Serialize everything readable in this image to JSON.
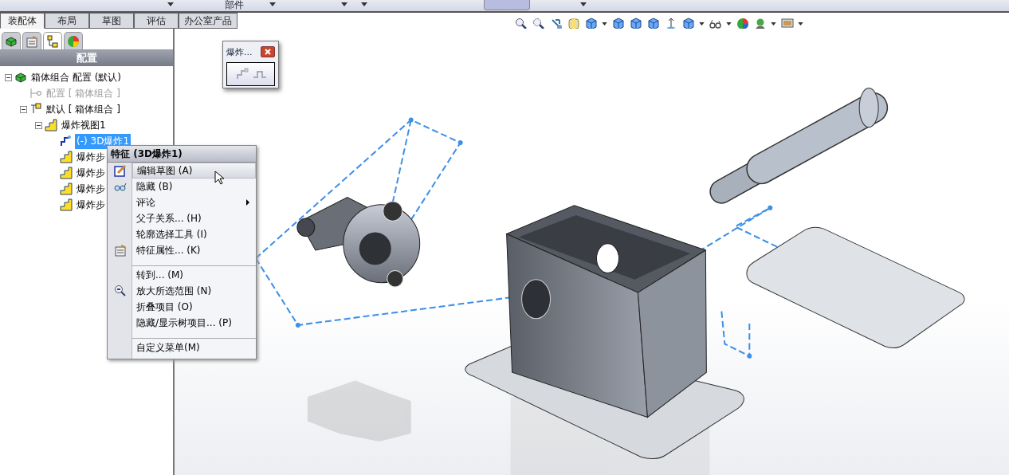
{
  "command_strip": {
    "label": "部件"
  },
  "tabs": [
    {
      "label": "装配体",
      "selected": true
    },
    {
      "label": "布局",
      "selected": false
    },
    {
      "label": "草图",
      "selected": false
    },
    {
      "label": "评估",
      "selected": false
    },
    {
      "label": "办公室产品",
      "selected": false
    }
  ],
  "panel_tabs": [
    {
      "selected": false
    },
    {
      "selected": false
    },
    {
      "selected": true
    },
    {
      "selected": false
    }
  ],
  "panel_title": "配置",
  "tree": [
    {
      "label": "箱体组合 配置  (默认)",
      "expanded": true,
      "disabled": false,
      "selected": false,
      "children": [
        {
          "label": "配置 [ 箱体组合 ]",
          "disabled": true,
          "selected": false
        },
        {
          "label": "默认 [ 箱体组合 ]",
          "expanded": true,
          "disabled": false,
          "selected": false,
          "children": [
            {
              "label": "爆炸视图1",
              "expanded": true,
              "disabled": false,
              "selected": false,
              "children": [
                {
                  "label": "(-) 3D爆炸1",
                  "disabled": false,
                  "selected": true
                },
                {
                  "label": "爆炸步",
                  "disabled": false,
                  "selected": false
                },
                {
                  "label": "爆炸步",
                  "disabled": false,
                  "selected": false
                },
                {
                  "label": "爆炸步",
                  "disabled": false,
                  "selected": false
                },
                {
                  "label": "爆炸步",
                  "disabled": false,
                  "selected": false
                }
              ]
            }
          ]
        }
      ]
    }
  ],
  "explode_popup": {
    "title": "爆炸..."
  },
  "context_menu": {
    "title": "特征 (3D爆炸1)",
    "items": [
      {
        "kind": "item",
        "label": "编辑草图 (A)",
        "highlighted": true
      },
      {
        "kind": "item",
        "label": "隐藏 (B)",
        "highlighted": false
      },
      {
        "kind": "submenu",
        "label": "评论",
        "highlighted": false
      },
      {
        "kind": "item",
        "label": "父子关系... (H)",
        "highlighted": false
      },
      {
        "kind": "item",
        "label": "轮廓选择工具 (I)",
        "highlighted": false
      },
      {
        "kind": "item",
        "label": "特征属性... (K)",
        "highlighted": false
      },
      {
        "kind": "separator"
      },
      {
        "kind": "item",
        "label": "转到... (M)",
        "highlighted": false
      },
      {
        "kind": "item",
        "label": "放大所选范围 (N)",
        "highlighted": false
      },
      {
        "kind": "item",
        "label": "折叠项目 (O)",
        "highlighted": false
      },
      {
        "kind": "item",
        "label": "隐藏/显示树项目... (P)",
        "highlighted": false
      },
      {
        "kind": "separator"
      },
      {
        "kind": "item",
        "label": "自定义菜单(M)",
        "highlighted": false
      }
    ]
  }
}
